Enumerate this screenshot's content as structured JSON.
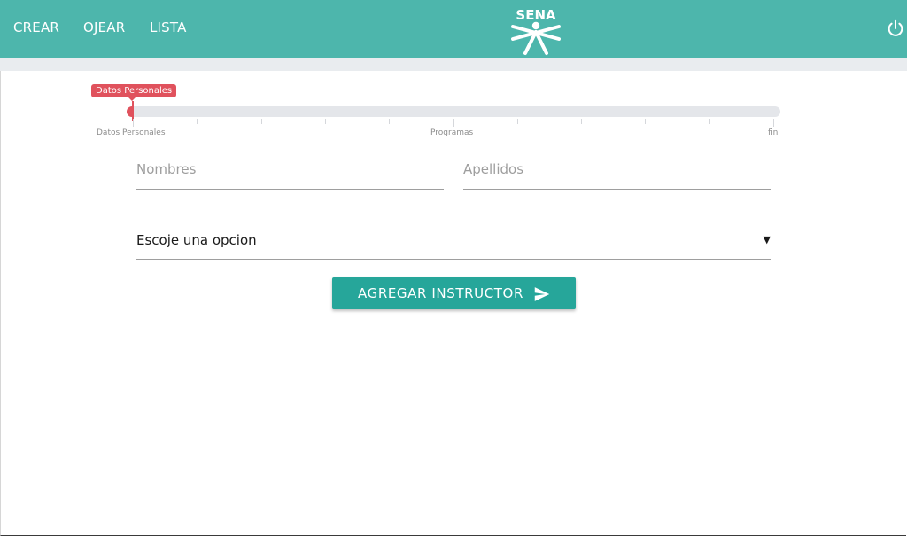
{
  "navbar": {
    "links": [
      {
        "label": "CREAR"
      },
      {
        "label": "OJEAR"
      },
      {
        "label": "LISTA"
      }
    ],
    "logo_text": "SENA",
    "background_color": "#4db6ac",
    "logout_icon": "power-icon"
  },
  "progress": {
    "tooltip": "Datos Personales",
    "value_fraction": 0.0,
    "tick_labels": {
      "start": "Datos Personales",
      "middle": "Programas",
      "end": "fin"
    },
    "color": "#e0525d"
  },
  "form": {
    "nombres_placeholder": "Nombres",
    "apellidos_placeholder": "Apellidos",
    "select_value": "Escoje una opcion",
    "submit_label": "AGREGAR INSTRUCTOR",
    "submit_icon": "send-icon",
    "button_color": "#26a69a"
  }
}
